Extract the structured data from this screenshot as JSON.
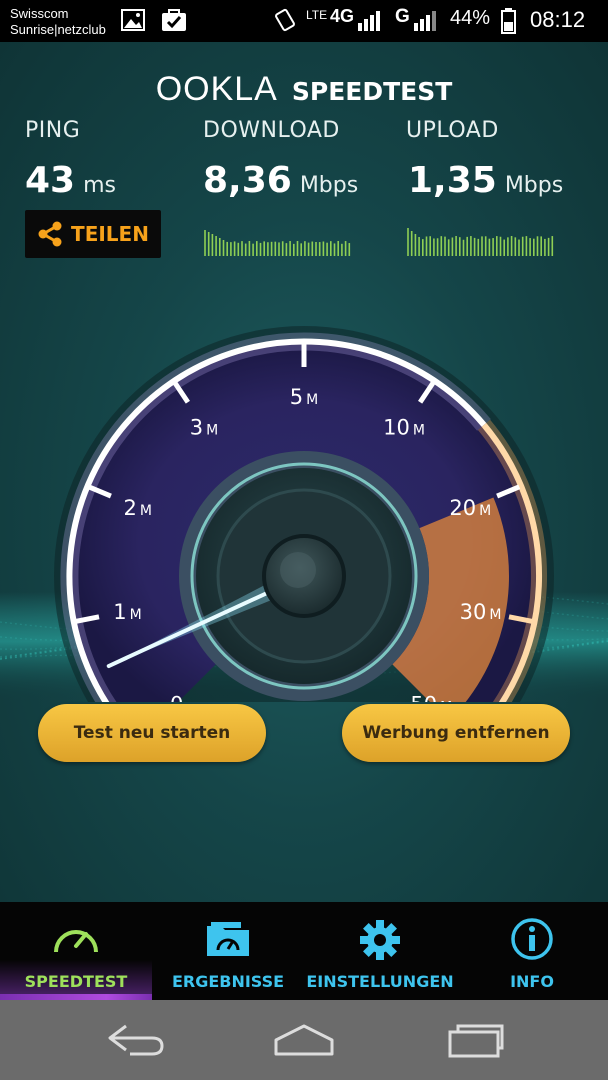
{
  "status_bar": {
    "carrier_line1": "Swisscom",
    "carrier_line2": "Sunrise|netzclub",
    "network_1": "LTE",
    "network_2": "4G",
    "network_3": "G",
    "battery": "44%",
    "time": "08:12"
  },
  "header": {
    "brand": "OOKLA",
    "product": "SPEEDTEST"
  },
  "metrics": {
    "ping": {
      "label": "PING",
      "value": "43",
      "unit": "ms"
    },
    "download": {
      "label": "DOWNLOAD",
      "value": "8,36",
      "unit": "Mbps"
    },
    "upload": {
      "label": "UPLOAD",
      "value": "1,35",
      "unit": "Mbps"
    }
  },
  "share_button": {
    "label": "TEILEN"
  },
  "gauge": {
    "ticks": [
      "0",
      "1",
      "2",
      "3",
      "5",
      "10",
      "20",
      "30",
      "50"
    ],
    "unit_suffix": "M",
    "needle_value_mbps": 0.6,
    "colors": {
      "arc": "#b9a9ff",
      "hot_zone": "#e58a3b",
      "needle": "#8fe8ff"
    }
  },
  "actions": {
    "restart": "Test neu starten",
    "remove_ads": "Werbung entfernen"
  },
  "bottom_nav": {
    "items": [
      {
        "label": "SPEEDTEST",
        "icon": "speedometer-icon",
        "active": true
      },
      {
        "label": "ERGEBNISSE",
        "icon": "results-folder-icon",
        "active": false
      },
      {
        "label": "EINSTELLUNGEN",
        "icon": "gear-icon",
        "active": false
      },
      {
        "label": "INFO",
        "icon": "info-icon",
        "active": false
      }
    ]
  },
  "system_nav": {
    "back": "back-icon",
    "home": "home-icon",
    "recents": "recents-icon"
  },
  "colors": {
    "background": "#154649",
    "accent": "#f7a21b",
    "nav_active": "#9ee05b",
    "nav_inactive": "#3ec4ee"
  }
}
